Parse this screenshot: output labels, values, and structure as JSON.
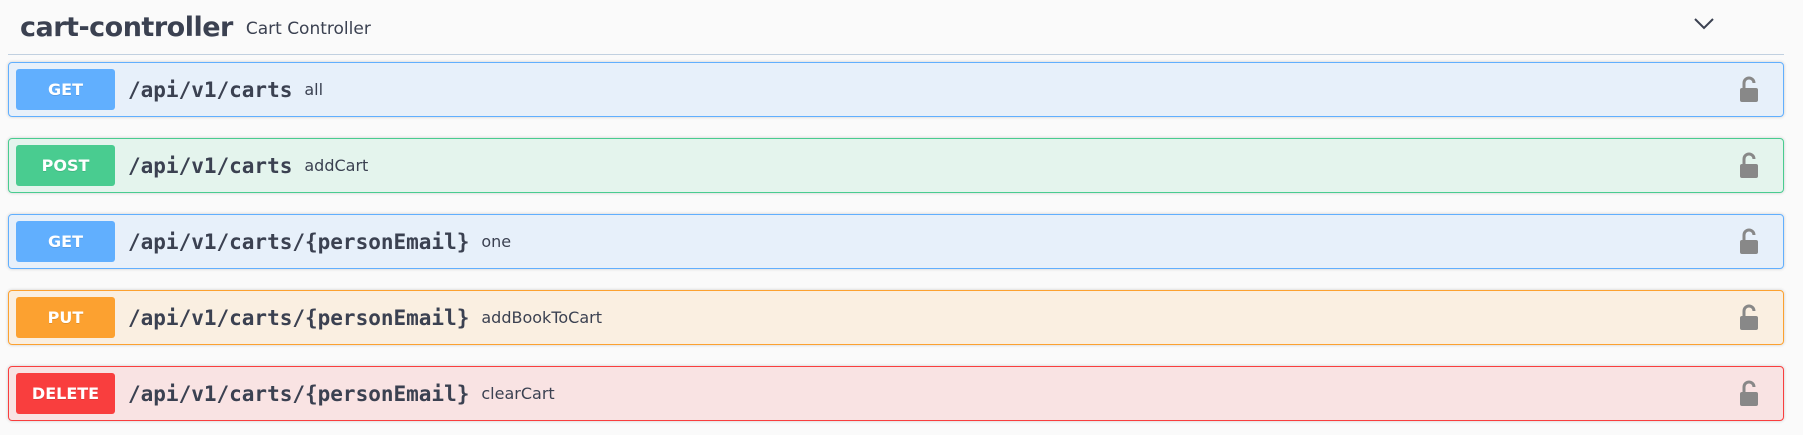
{
  "tag": {
    "name": "cart-controller",
    "description": "Cart Controller",
    "expand_icon": "chevron-down-icon"
  },
  "operations": [
    {
      "method": "GET",
      "path": "/api/v1/carts",
      "summary": "all",
      "color": "#61affe",
      "lock_icon": "unlocked-padlock-icon"
    },
    {
      "method": "POST",
      "path": "/api/v1/carts",
      "summary": "addCart",
      "color": "#49cc90",
      "lock_icon": "unlocked-padlock-icon"
    },
    {
      "method": "GET",
      "path": "/api/v1/carts/{personEmail}",
      "summary": "one",
      "color": "#61affe",
      "lock_icon": "unlocked-padlock-icon"
    },
    {
      "method": "PUT",
      "path": "/api/v1/carts/{personEmail}",
      "summary": "addBookToCart",
      "color": "#fca130",
      "lock_icon": "unlocked-padlock-icon"
    },
    {
      "method": "DELETE",
      "path": "/api/v1/carts/{personEmail}",
      "summary": "clearCart",
      "color": "#f93e3e",
      "lock_icon": "unlocked-padlock-icon"
    }
  ]
}
